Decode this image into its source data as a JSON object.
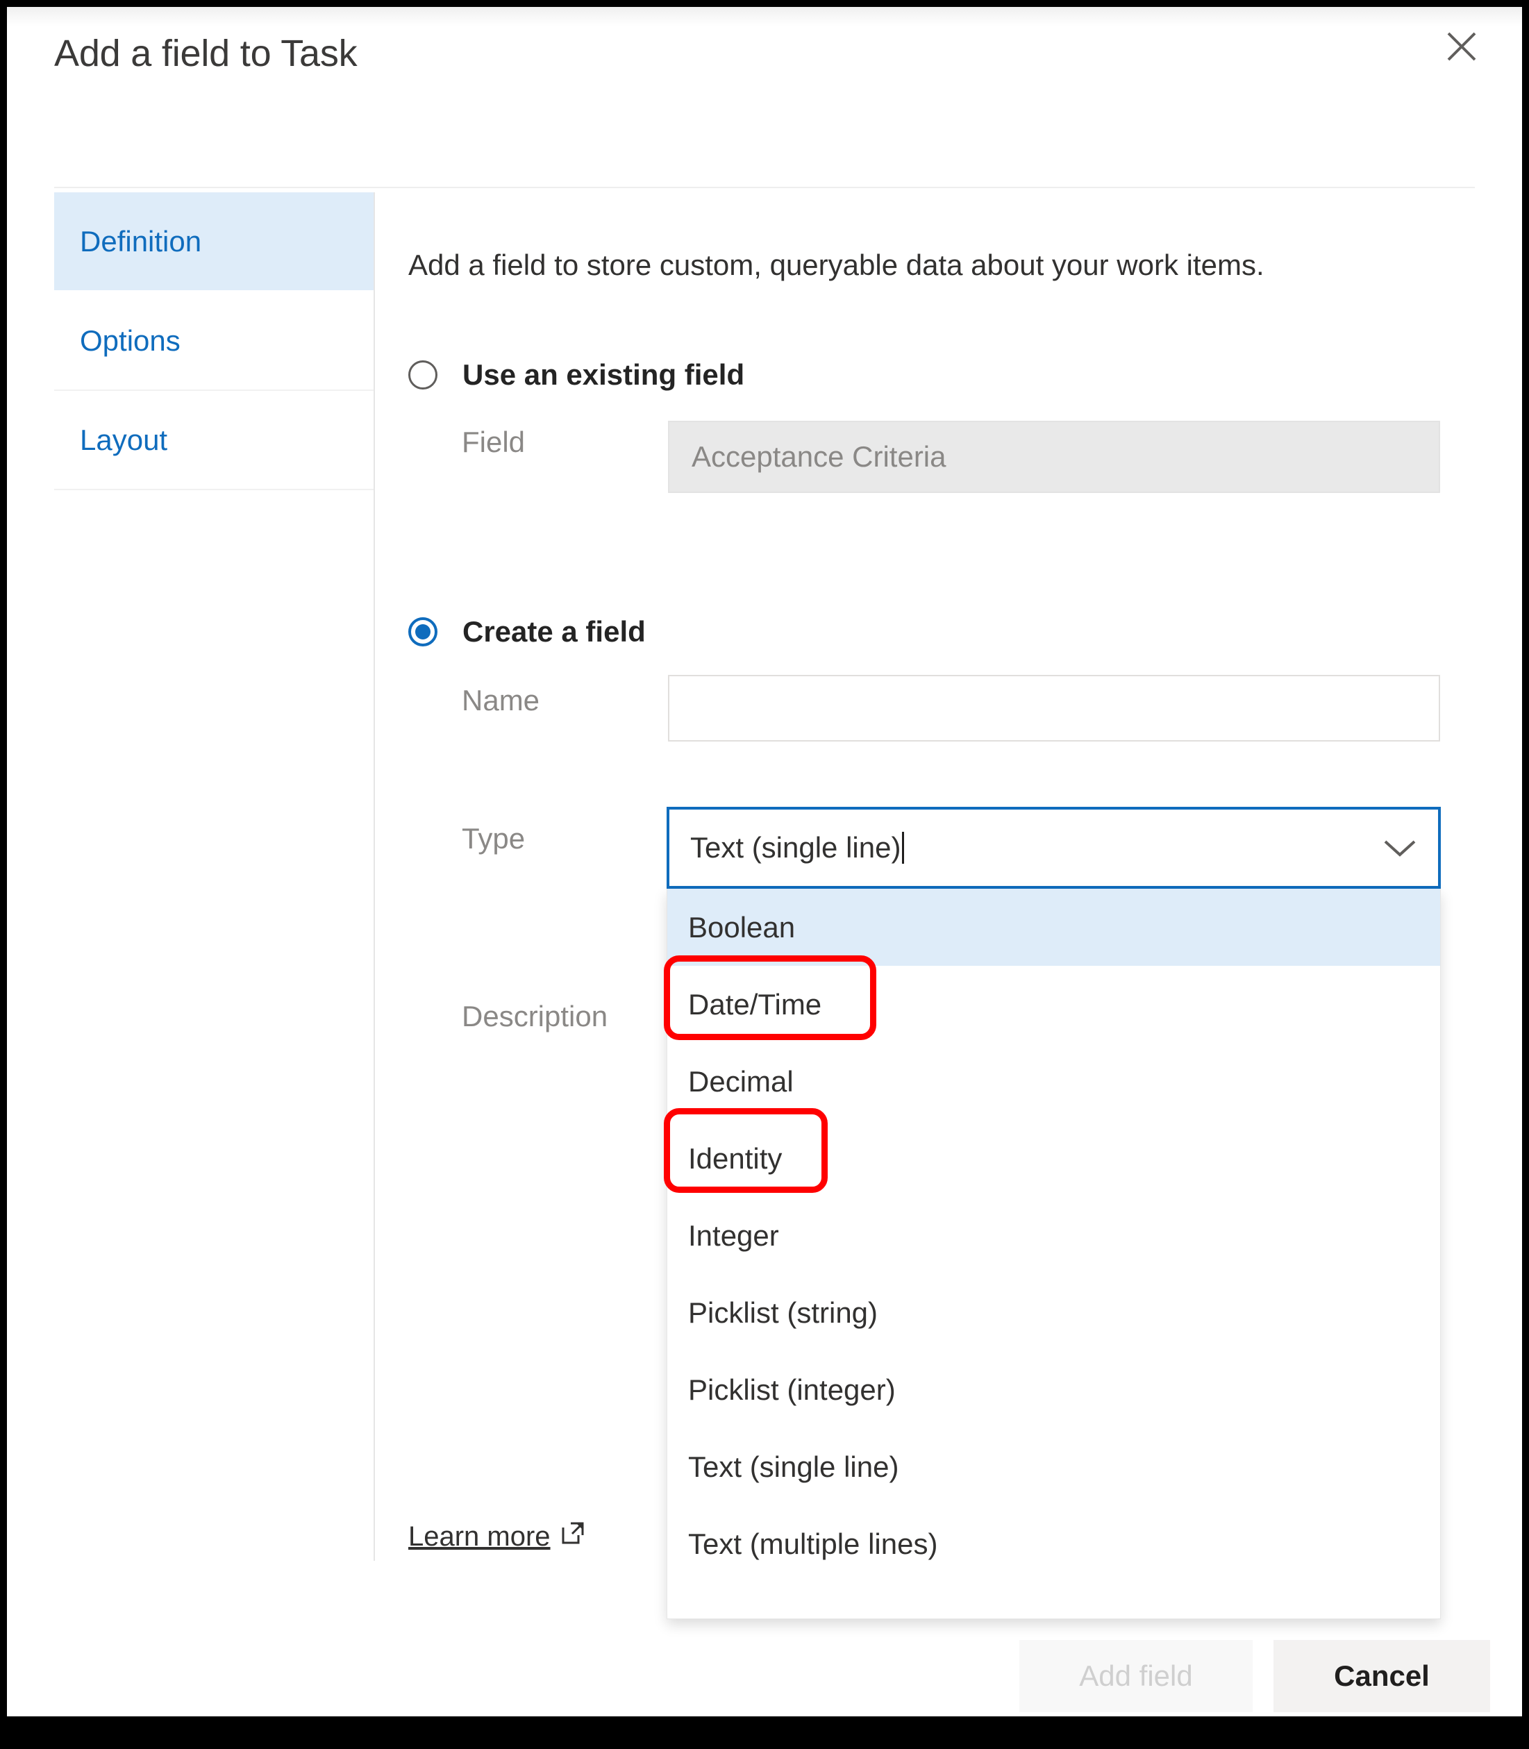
{
  "dialog": {
    "title": "Add a field to Task",
    "close_icon": "close-icon"
  },
  "sidebar": {
    "items": [
      {
        "label": "Definition",
        "active": true
      },
      {
        "label": "Options",
        "active": false
      },
      {
        "label": "Layout",
        "active": false
      }
    ]
  },
  "main": {
    "intro": "Add a field to store custom, queryable data about your work items.",
    "existing": {
      "radio_label": "Use an existing field",
      "selected": false,
      "field_label": "Field",
      "field_value": "Acceptance Criteria"
    },
    "create": {
      "radio_label": "Create a field",
      "selected": true,
      "name_label": "Name",
      "name_value": "",
      "name_placeholder": "",
      "type_label": "Type",
      "type_value": "Text (single line)",
      "description_label": "Description",
      "description_value": ""
    },
    "type_dropdown": {
      "expanded": true,
      "highlighted": "Boolean",
      "chevron_icon": "chevron-down-icon",
      "options": [
        {
          "label": "Boolean",
          "highlighted": true,
          "annotated": false
        },
        {
          "label": "Date/Time",
          "highlighted": false,
          "annotated": true
        },
        {
          "label": "Decimal",
          "highlighted": false,
          "annotated": false
        },
        {
          "label": "Identity",
          "highlighted": false,
          "annotated": true
        },
        {
          "label": "Integer",
          "highlighted": false,
          "annotated": false
        },
        {
          "label": "Picklist (string)",
          "highlighted": false,
          "annotated": false
        },
        {
          "label": "Picklist (integer)",
          "highlighted": false,
          "annotated": false
        },
        {
          "label": "Text (single line)",
          "highlighted": false,
          "annotated": false
        },
        {
          "label": "Text (multiple lines)",
          "highlighted": false,
          "annotated": false
        }
      ]
    },
    "learn_more": {
      "label": "Learn more",
      "icon": "external-link-icon"
    }
  },
  "footer": {
    "submit_label": "Add field",
    "submit_disabled": true,
    "cancel_label": "Cancel"
  },
  "colors": {
    "accent": "#0f6cbd",
    "annotation": "#ff0000",
    "nav_active_bg": "#deecf9",
    "highlight_bg": "#deecf9"
  }
}
